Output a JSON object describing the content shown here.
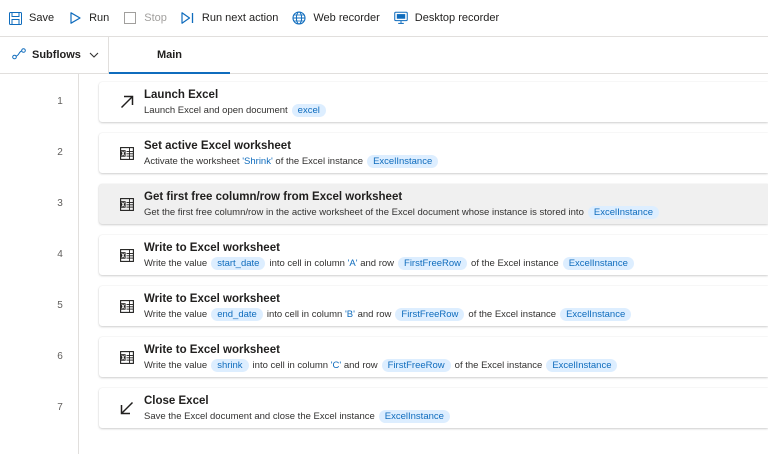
{
  "toolbar": {
    "save": "Save",
    "run": "Run",
    "stop": "Stop",
    "run_next": "Run next action",
    "web_recorder": "Web recorder",
    "desktop_recorder": "Desktop recorder"
  },
  "tabs": {
    "subflows": "Subflows",
    "main": "Main"
  },
  "colors": {
    "accent": "#0f6cbd",
    "chip_bg": "#ddeeff",
    "selected_row": "#f0f0f0"
  },
  "steps": [
    {
      "num": "1",
      "icon": "launch-arrow-icon",
      "title": "Launch Excel",
      "desc": {
        "t1": "Launch Excel and open document",
        "v1": "excel"
      }
    },
    {
      "num": "2",
      "icon": "excel-worksheet-icon",
      "title": "Set active Excel worksheet",
      "desc": {
        "t1": "Activate the worksheet ",
        "q1": "'Shrink'",
        "t2": " of the Excel instance",
        "v1": "ExcelInstance"
      }
    },
    {
      "num": "3",
      "icon": "excel-worksheet-icon",
      "title": "Get first free column/row from Excel worksheet",
      "desc": {
        "t1": "Get the first free column/row in the active worksheet of the Excel document whose instance is stored into",
        "v1": "ExcelInstance"
      }
    },
    {
      "num": "4",
      "icon": "excel-worksheet-icon",
      "title": "Write to Excel worksheet",
      "desc": {
        "t1": "Write the value",
        "v1": "start_date",
        "t2": "into cell in column ",
        "q1": "'A'",
        "t3": " and row",
        "v2": "FirstFreeRow",
        "t4": "of the Excel instance",
        "v3": "ExcelInstance"
      }
    },
    {
      "num": "5",
      "icon": "excel-worksheet-icon",
      "title": "Write to Excel worksheet",
      "desc": {
        "t1": "Write the value",
        "v1": "end_date",
        "t2": "into cell in column ",
        "q1": "'B'",
        "t3": " and row",
        "v2": "FirstFreeRow",
        "t4": "of the Excel instance",
        "v3": "ExcelInstance"
      }
    },
    {
      "num": "6",
      "icon": "excel-worksheet-icon",
      "title": "Write to Excel worksheet",
      "desc": {
        "t1": "Write the value",
        "v1": "shrink",
        "t2": "into cell in column ",
        "q1": "'C'",
        "t3": " and row",
        "v2": "FirstFreeRow",
        "t4": "of the Excel instance",
        "v3": "ExcelInstance"
      }
    },
    {
      "num": "7",
      "icon": "close-arrow-icon",
      "title": "Close Excel",
      "desc": {
        "t1": "Save the Excel document and close the Excel instance",
        "v1": "ExcelInstance"
      }
    }
  ]
}
